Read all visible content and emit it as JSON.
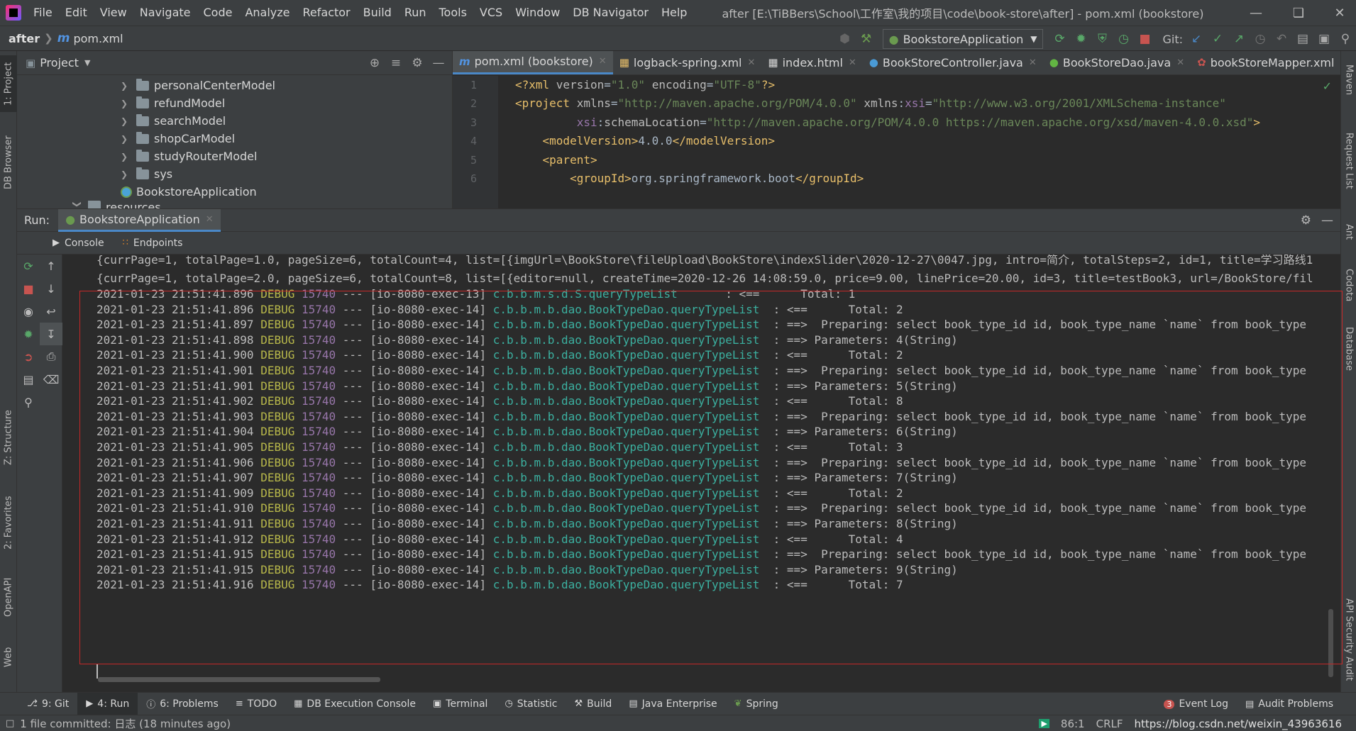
{
  "window": {
    "menus": [
      "File",
      "Edit",
      "View",
      "Navigate",
      "Code",
      "Analyze",
      "Refactor",
      "Build",
      "Run",
      "Tools",
      "VCS",
      "Window",
      "DB Navigator",
      "Help"
    ],
    "title": "after [E:\\TiBBers\\School\\工作室\\我的项目\\code\\book-store\\after] - pom.xml (bookstore)"
  },
  "navbar": {
    "root": "after",
    "file": "pom.xml",
    "run_config": "BookstoreApplication",
    "git_label": "Git:"
  },
  "project": {
    "title": "Project",
    "items": [
      {
        "label": "personalCenterModel",
        "type": "folder"
      },
      {
        "label": "refundModel",
        "type": "folder"
      },
      {
        "label": "searchModel",
        "type": "folder"
      },
      {
        "label": "shopCarModel",
        "type": "folder"
      },
      {
        "label": "studyRouterModel",
        "type": "folder"
      },
      {
        "label": "sys",
        "type": "folder"
      },
      {
        "label": "BookstoreApplication",
        "type": "spring-class"
      },
      {
        "label": "resources",
        "type": "folder"
      }
    ]
  },
  "editor": {
    "tabs": [
      {
        "label": "pom.xml (bookstore)",
        "icon": "m-icon",
        "active": true
      },
      {
        "label": "logback-spring.xml",
        "icon": "xml-icon",
        "active": false
      },
      {
        "label": "index.html",
        "icon": "html-icon",
        "active": false
      },
      {
        "label": "BookStoreController.java",
        "icon": "class-icon",
        "active": false
      },
      {
        "label": "BookStoreDao.java",
        "icon": "interface-icon",
        "active": false
      },
      {
        "label": "bookStoreMapper.xml",
        "icon": "mybatis-icon",
        "active": false
      }
    ],
    "line_numbers": [
      "1",
      "2",
      "3",
      "4",
      "5",
      "6"
    ]
  },
  "run": {
    "label": "Run:",
    "tab": "BookstoreApplication",
    "subtabs": [
      "Console",
      "Endpoints"
    ],
    "top_lines": [
      "{currPage=1, totalPage=1.0, pageSize=6, totalCount=4, list=[{imgUrl=\\BookStore\\fileUpload\\BookStore\\indexSlider\\2020-12-27\\0047.jpg, intro=简介, totalSteps=2, id=1, title=学习路线1",
      "{currPage=1, totalPage=2.0, pageSize=6, totalCount=8, list=[{editor=null, createTime=2020-12-26 14:08:59.0, price=9.00, linePrice=20.00, id=3, title=testBook3, url=/BookStore/fil"
    ],
    "log_lines": [
      {
        "ts": "2021-01-23 21:51:41.896",
        "level": "DEBUG",
        "pid": "15740",
        "thread": "--- [io-8080-exec-13]",
        "logger": "c.b.b.m.s.d.S.queryTypeList      ",
        "msg": " : <==      Total: 1"
      },
      {
        "ts": "2021-01-23 21:51:41.896",
        "level": "DEBUG",
        "pid": "15740",
        "thread": "--- [io-8080-exec-14]",
        "logger": "c.b.b.m.b.dao.BookTypeDao.queryTypeList",
        "msg": "  : <==      Total: 2"
      },
      {
        "ts": "2021-01-23 21:51:41.897",
        "level": "DEBUG",
        "pid": "15740",
        "thread": "--- [io-8080-exec-14]",
        "logger": "c.b.b.m.b.dao.BookTypeDao.queryTypeList",
        "msg": "  : ==>  Preparing: select book_type_id id, book_type_name `name` from book_type"
      },
      {
        "ts": "2021-01-23 21:51:41.898",
        "level": "DEBUG",
        "pid": "15740",
        "thread": "--- [io-8080-exec-14]",
        "logger": "c.b.b.m.b.dao.BookTypeDao.queryTypeList",
        "msg": "  : ==> Parameters: 4(String)"
      },
      {
        "ts": "2021-01-23 21:51:41.900",
        "level": "DEBUG",
        "pid": "15740",
        "thread": "--- [io-8080-exec-14]",
        "logger": "c.b.b.m.b.dao.BookTypeDao.queryTypeList",
        "msg": "  : <==      Total: 2"
      },
      {
        "ts": "2021-01-23 21:51:41.901",
        "level": "DEBUG",
        "pid": "15740",
        "thread": "--- [io-8080-exec-14]",
        "logger": "c.b.b.m.b.dao.BookTypeDao.queryTypeList",
        "msg": "  : ==>  Preparing: select book_type_id id, book_type_name `name` from book_type"
      },
      {
        "ts": "2021-01-23 21:51:41.901",
        "level": "DEBUG",
        "pid": "15740",
        "thread": "--- [io-8080-exec-14]",
        "logger": "c.b.b.m.b.dao.BookTypeDao.queryTypeList",
        "msg": "  : ==> Parameters: 5(String)"
      },
      {
        "ts": "2021-01-23 21:51:41.902",
        "level": "DEBUG",
        "pid": "15740",
        "thread": "--- [io-8080-exec-14]",
        "logger": "c.b.b.m.b.dao.BookTypeDao.queryTypeList",
        "msg": "  : <==      Total: 8"
      },
      {
        "ts": "2021-01-23 21:51:41.903",
        "level": "DEBUG",
        "pid": "15740",
        "thread": "--- [io-8080-exec-14]",
        "logger": "c.b.b.m.b.dao.BookTypeDao.queryTypeList",
        "msg": "  : ==>  Preparing: select book_type_id id, book_type_name `name` from book_type"
      },
      {
        "ts": "2021-01-23 21:51:41.904",
        "level": "DEBUG",
        "pid": "15740",
        "thread": "--- [io-8080-exec-14]",
        "logger": "c.b.b.m.b.dao.BookTypeDao.queryTypeList",
        "msg": "  : ==> Parameters: 6(String)"
      },
      {
        "ts": "2021-01-23 21:51:41.905",
        "level": "DEBUG",
        "pid": "15740",
        "thread": "--- [io-8080-exec-14]",
        "logger": "c.b.b.m.b.dao.BookTypeDao.queryTypeList",
        "msg": "  : <==      Total: 3"
      },
      {
        "ts": "2021-01-23 21:51:41.906",
        "level": "DEBUG",
        "pid": "15740",
        "thread": "--- [io-8080-exec-14]",
        "logger": "c.b.b.m.b.dao.BookTypeDao.queryTypeList",
        "msg": "  : ==>  Preparing: select book_type_id id, book_type_name `name` from book_type"
      },
      {
        "ts": "2021-01-23 21:51:41.907",
        "level": "DEBUG",
        "pid": "15740",
        "thread": "--- [io-8080-exec-14]",
        "logger": "c.b.b.m.b.dao.BookTypeDao.queryTypeList",
        "msg": "  : ==> Parameters: 7(String)"
      },
      {
        "ts": "2021-01-23 21:51:41.909",
        "level": "DEBUG",
        "pid": "15740",
        "thread": "--- [io-8080-exec-14]",
        "logger": "c.b.b.m.b.dao.BookTypeDao.queryTypeList",
        "msg": "  : <==      Total: 2"
      },
      {
        "ts": "2021-01-23 21:51:41.910",
        "level": "DEBUG",
        "pid": "15740",
        "thread": "--- [io-8080-exec-14]",
        "logger": "c.b.b.m.b.dao.BookTypeDao.queryTypeList",
        "msg": "  : ==>  Preparing: select book_type_id id, book_type_name `name` from book_type"
      },
      {
        "ts": "2021-01-23 21:51:41.911",
        "level": "DEBUG",
        "pid": "15740",
        "thread": "--- [io-8080-exec-14]",
        "logger": "c.b.b.m.b.dao.BookTypeDao.queryTypeList",
        "msg": "  : ==> Parameters: 8(String)"
      },
      {
        "ts": "2021-01-23 21:51:41.912",
        "level": "DEBUG",
        "pid": "15740",
        "thread": "--- [io-8080-exec-14]",
        "logger": "c.b.b.m.b.dao.BookTypeDao.queryTypeList",
        "msg": "  : <==      Total: 4"
      },
      {
        "ts": "2021-01-23 21:51:41.915",
        "level": "DEBUG",
        "pid": "15740",
        "thread": "--- [io-8080-exec-14]",
        "logger": "c.b.b.m.b.dao.BookTypeDao.queryTypeList",
        "msg": "  : ==>  Preparing: select book_type_id id, book_type_name `name` from book_type"
      },
      {
        "ts": "2021-01-23 21:51:41.915",
        "level": "DEBUG",
        "pid": "15740",
        "thread": "--- [io-8080-exec-14]",
        "logger": "c.b.b.m.b.dao.BookTypeDao.queryTypeList",
        "msg": "  : ==> Parameters: 9(String)"
      },
      {
        "ts": "2021-01-23 21:51:41.916",
        "level": "DEBUG",
        "pid": "15740",
        "thread": "--- [io-8080-exec-14]",
        "logger": "c.b.b.m.b.dao.BookTypeDao.queryTypeList",
        "msg": "  : <==      Total: 7"
      }
    ]
  },
  "left_strip": [
    "1: Project",
    "DB Browser",
    "Z: Structure",
    "2: Favorites",
    "OpenAPI",
    "Web"
  ],
  "right_strip": [
    "Maven",
    "Request List",
    "Ant",
    "Codota",
    "Database",
    "API Security Audit"
  ],
  "bottom_tabs": [
    {
      "label": "9: Git",
      "icon": "git-icon"
    },
    {
      "label": "4: Run",
      "icon": "run-icon",
      "active": true
    },
    {
      "label": "6: Problems",
      "icon": "problems-icon"
    },
    {
      "label": "TODO",
      "icon": "todo-icon"
    },
    {
      "label": "DB Execution Console",
      "icon": "db-console-icon"
    },
    {
      "label": "Terminal",
      "icon": "terminal-icon"
    },
    {
      "label": "Statistic",
      "icon": "statistic-icon"
    },
    {
      "label": "Build",
      "icon": "build-icon"
    },
    {
      "label": "Java Enterprise",
      "icon": "java-enterprise-icon"
    },
    {
      "label": "Spring",
      "icon": "spring-icon"
    }
  ],
  "bottom_right": {
    "event_log": "Event Log",
    "event_log_count": "3",
    "audit_problems": "Audit Problems"
  },
  "status": {
    "message": "1 file committed: 日志 (18 minutes ago)",
    "position": "86:1",
    "line_sep": "CRLF",
    "watermark": "https://blog.csdn.net/weixin_43963616"
  },
  "colors": {
    "accent": "#4a88c7",
    "highlight_box": "#c62828",
    "debug": "#b8b84a",
    "logger": "#3bb0a0"
  }
}
